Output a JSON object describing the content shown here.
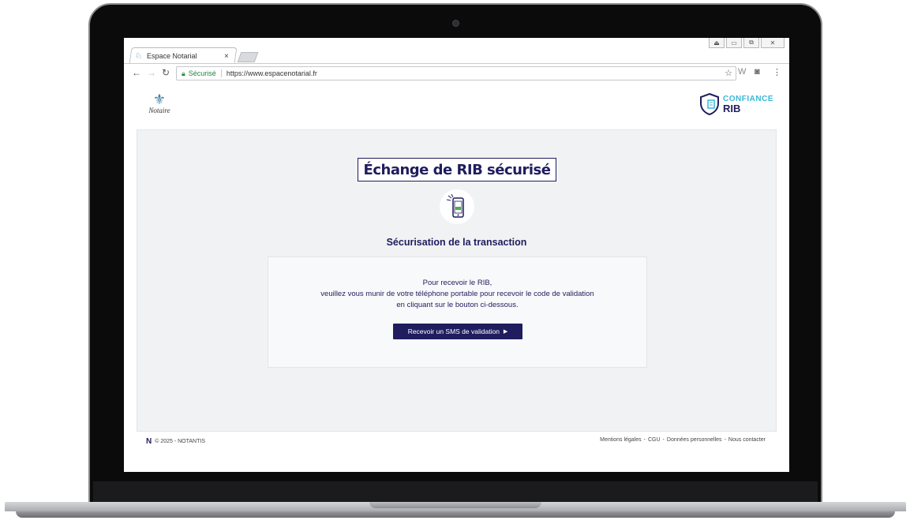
{
  "browser": {
    "tab_title": "Espace Notarial",
    "tab_close": "×",
    "secure_label": "Sécurisé",
    "url": "https://www.espacenotarial.fr"
  },
  "header": {
    "notaire_logo_text": "Notaire",
    "confiance_label": "CONFIANCE",
    "rib_label": "RIB"
  },
  "main": {
    "title": "Échange de RIB sécurisé",
    "subtitle": "Sécurisation de la transaction",
    "message_line1": "Pour recevoir le RIB,",
    "message_line2": "veuillez vous munir de votre téléphone portable pour recevoir le code de validation",
    "message_line3": "en cliquant sur le bouton ci-dessous.",
    "sms_button_label": "Recevoir un SMS de validation"
  },
  "footer": {
    "copyright": "© 2025 - NOTANTIS",
    "links": [
      "Mentions légales",
      "CGU",
      "Données personnelles",
      "Nous contacter"
    ],
    "separator": "-"
  },
  "colors": {
    "brand_navy": "#1f1d5e",
    "brand_cyan": "#3ab8d8",
    "secure_green": "#1a8a3d"
  }
}
